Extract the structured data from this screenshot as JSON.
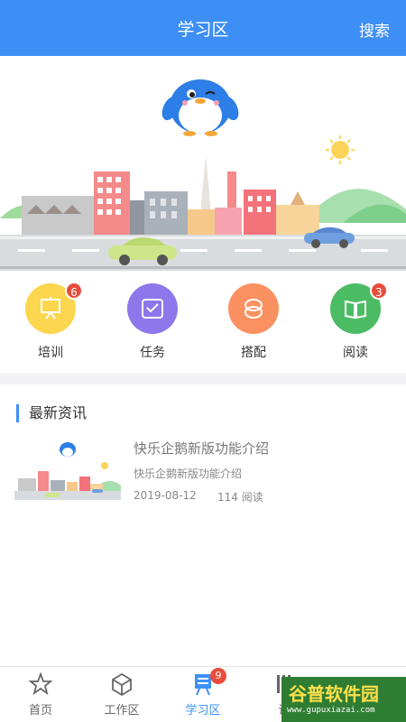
{
  "header": {
    "title": "学习区",
    "search_label": "搜索"
  },
  "quick_links": [
    {
      "label": "培训",
      "badge": "6",
      "color": "#fbd64e",
      "icon": "presentation-board-icon"
    },
    {
      "label": "任务",
      "badge": "",
      "color": "#8d77ea",
      "icon": "check-tray-icon"
    },
    {
      "label": "搭配",
      "badge": "",
      "color": "#fb9160",
      "icon": "link-rings-icon"
    },
    {
      "label": "阅读",
      "badge": "3",
      "color": "#4cbc64",
      "icon": "open-book-icon"
    }
  ],
  "news": {
    "section_title": "最新资讯",
    "articles": [
      {
        "title": "快乐企鹅新版功能介绍",
        "subtitle": "快乐企鹅新版功能介绍",
        "date": "2019-08-12",
        "reads": "114 阅读"
      }
    ]
  },
  "tabbar": [
    {
      "label": "首页",
      "icon": "star-home-icon",
      "active": false
    },
    {
      "label": "工作区",
      "icon": "cube-icon",
      "active": false
    },
    {
      "label": "学习区",
      "icon": "book-stack-icon",
      "active": true,
      "badge": "9"
    },
    {
      "label": "课",
      "icon": "course-icon",
      "active": false
    }
  ],
  "watermark": {
    "cn": "谷普软件园",
    "url": "www.gupuxiazai.com"
  },
  "colors": {
    "primary": "#3d8ff5",
    "badge": "#e74c3c"
  }
}
